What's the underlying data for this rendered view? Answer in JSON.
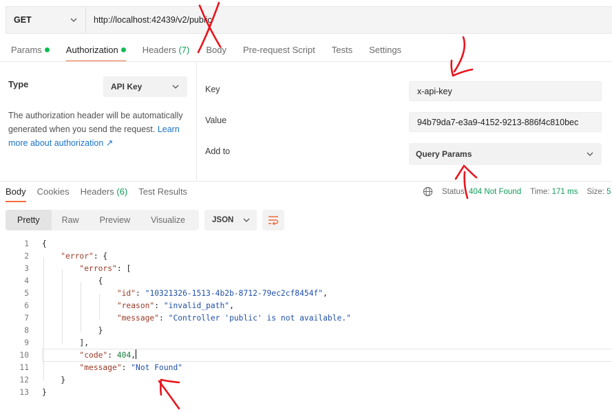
{
  "request": {
    "method": "GET",
    "url": "http://localhost:42439/v2/public",
    "tabs": [
      {
        "label": "Params",
        "count": "",
        "dot": true
      },
      {
        "label": "Authorization",
        "count": "",
        "dot": true
      },
      {
        "label": "Headers ",
        "count": "(7)",
        "dot": false
      },
      {
        "label": "Body",
        "count": "",
        "dot": false
      },
      {
        "label": "Pre-request Script",
        "count": "",
        "dot": false
      },
      {
        "label": "Tests",
        "count": "",
        "dot": false
      },
      {
        "label": "Settings",
        "count": "",
        "dot": false
      }
    ]
  },
  "auth": {
    "type_label": "Type",
    "type_value": "API Key",
    "description": "The authorization header will be automatically generated when you send the request. ",
    "learn_more": "Learn more about authorization ↗",
    "key_label": "Key",
    "key_value": "x-api-key",
    "value_label": "Value",
    "value_value": "94b79da7-e3a9-4152-9213-886f4c810bec",
    "addto_label": "Add to",
    "addto_value": "Query Params"
  },
  "response": {
    "tabs": [
      {
        "label": "Body",
        "count": ""
      },
      {
        "label": "Cookies",
        "count": ""
      },
      {
        "label": "Headers ",
        "count": "(6)"
      },
      {
        "label": "Test Results",
        "count": ""
      }
    ],
    "status_label": "Status:",
    "status_value": "404 Not Found",
    "time_label": "Time:",
    "time_value": "171 ms",
    "size_label": "Size:",
    "size_value": "5",
    "views": [
      "Pretty",
      "Raw",
      "Preview",
      "Visualize"
    ],
    "format": "JSON"
  },
  "code_lines": [
    {
      "n": "1",
      "tokens": [
        {
          "t": "p",
          "v": "{"
        }
      ]
    },
    {
      "n": "2",
      "tokens": [
        {
          "t": "p",
          "v": "    "
        },
        {
          "t": "k",
          "v": "\"error\""
        },
        {
          "t": "p",
          "v": ": {"
        }
      ]
    },
    {
      "n": "3",
      "tokens": [
        {
          "t": "p",
          "v": "        "
        },
        {
          "t": "k",
          "v": "\"errors\""
        },
        {
          "t": "p",
          "v": ": ["
        }
      ]
    },
    {
      "n": "4",
      "tokens": [
        {
          "t": "p",
          "v": "            {"
        }
      ]
    },
    {
      "n": "5",
      "tokens": [
        {
          "t": "p",
          "v": "                "
        },
        {
          "t": "k",
          "v": "\"id\""
        },
        {
          "t": "p",
          "v": ": "
        },
        {
          "t": "s",
          "v": "\"10321326-1513-4b2b-8712-79ec2cf8454f\""
        },
        {
          "t": "p",
          "v": ","
        }
      ]
    },
    {
      "n": "6",
      "tokens": [
        {
          "t": "p",
          "v": "                "
        },
        {
          "t": "k",
          "v": "\"reason\""
        },
        {
          "t": "p",
          "v": ": "
        },
        {
          "t": "s",
          "v": "\"invalid_path\""
        },
        {
          "t": "p",
          "v": ","
        }
      ]
    },
    {
      "n": "7",
      "tokens": [
        {
          "t": "p",
          "v": "                "
        },
        {
          "t": "k",
          "v": "\"message\""
        },
        {
          "t": "p",
          "v": ": "
        },
        {
          "t": "s",
          "v": "\"Controller 'public' is not available.\""
        }
      ]
    },
    {
      "n": "8",
      "tokens": [
        {
          "t": "p",
          "v": "            }"
        }
      ]
    },
    {
      "n": "9",
      "tokens": [
        {
          "t": "p",
          "v": "        ],"
        }
      ]
    },
    {
      "n": "10",
      "tokens": [
        {
          "t": "p",
          "v": "        "
        },
        {
          "t": "k",
          "v": "\"code\""
        },
        {
          "t": "p",
          "v": ": "
        },
        {
          "t": "n",
          "v": "404"
        },
        {
          "t": "p",
          "v": ","
        }
      ]
    },
    {
      "n": "11",
      "tokens": [
        {
          "t": "p",
          "v": "        "
        },
        {
          "t": "k",
          "v": "\"message\""
        },
        {
          "t": "p",
          "v": ": "
        },
        {
          "t": "s",
          "v": "\"Not Found\""
        }
      ]
    },
    {
      "n": "12",
      "tokens": [
        {
          "t": "p",
          "v": "    }"
        }
      ]
    },
    {
      "n": "13",
      "tokens": [
        {
          "t": "p",
          "v": "}"
        }
      ]
    }
  ],
  "colors": {
    "accent": "#f26b3a",
    "status_green": "#0f9d58",
    "link_blue": "#1a73c9",
    "annotation_red": "#e8141c"
  }
}
